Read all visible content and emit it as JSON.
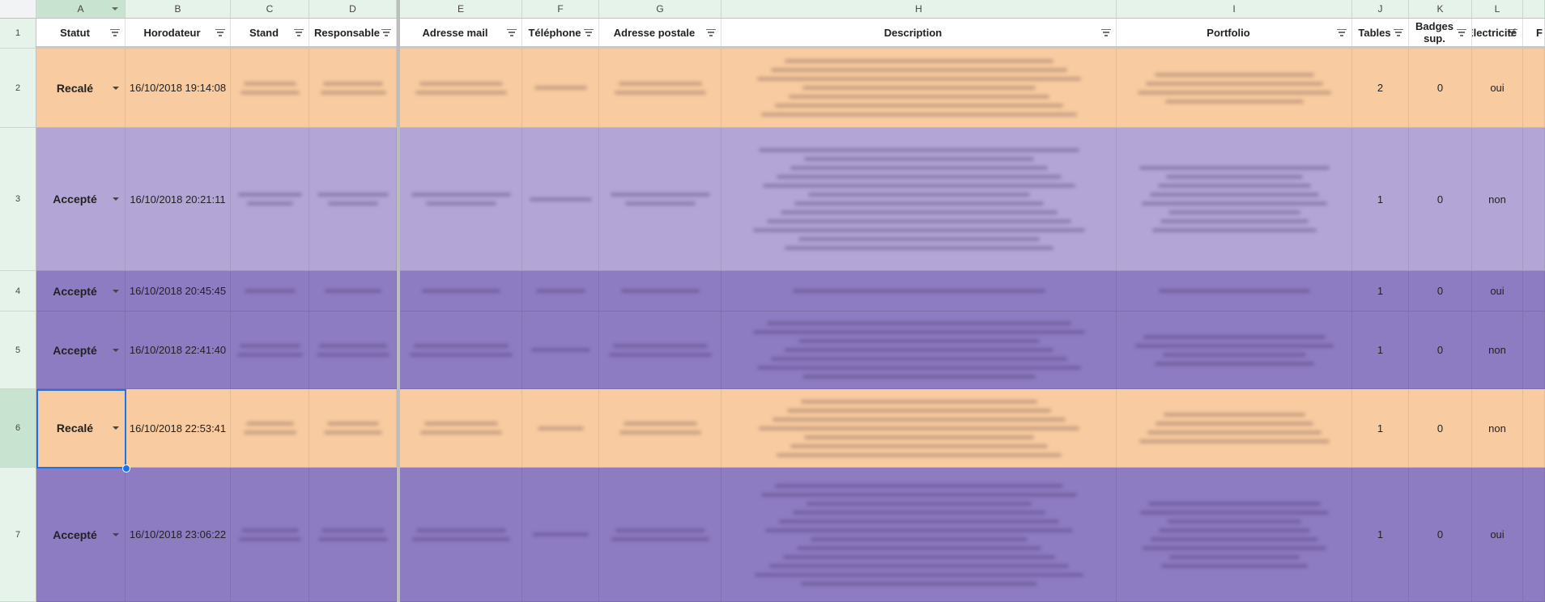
{
  "columns": [
    {
      "letter": "A"
    },
    {
      "letter": "B"
    },
    {
      "letter": "C"
    },
    {
      "letter": "D"
    },
    {
      "letter": "E"
    },
    {
      "letter": "F"
    },
    {
      "letter": "G"
    },
    {
      "letter": "H"
    },
    {
      "letter": "I"
    },
    {
      "letter": "J"
    },
    {
      "letter": "K"
    },
    {
      "letter": "L"
    }
  ],
  "header": {
    "statut": "Statut",
    "horodateur": "Horodateur",
    "stand": "Stand",
    "responsable": "Responsable",
    "adresse_mail": "Adresse mail",
    "telephone": "Téléphone",
    "adresse_postale": "Adresse postale",
    "description": "Description",
    "portfolio": "Portfolio",
    "tables": "Tables",
    "badges": "Badges sup.",
    "electricite": "Electricité",
    "next_truncated": "F"
  },
  "colors": {
    "recale": "#f8cba0",
    "accepte_light": "#b3a6d6",
    "accepte_dark": "#8e7cc3",
    "selection": "#1a73e8"
  },
  "rows": [
    {
      "num": "1"
    },
    {
      "num": "2",
      "statut": "Recalé",
      "horodateur": "16/10/2018 19:14:08",
      "tables": "2",
      "badges": "0",
      "electricite": "oui",
      "style": "recale"
    },
    {
      "num": "3",
      "statut": "Accepté",
      "horodateur": "16/10/2018 20:21:11",
      "tables": "1",
      "badges": "0",
      "electricite": "non",
      "style": "accepte_light"
    },
    {
      "num": "4",
      "statut": "Accepté",
      "horodateur": "16/10/2018 20:45:45",
      "tables": "1",
      "badges": "0",
      "electricite": "oui",
      "style": "accepte_dark"
    },
    {
      "num": "5",
      "statut": "Accepté",
      "horodateur": "16/10/2018 22:41:40",
      "tables": "1",
      "badges": "0",
      "electricite": "non",
      "style": "accepte_dark"
    },
    {
      "num": "6",
      "statut": "Recalé",
      "horodateur": "16/10/2018 22:53:41",
      "tables": "1",
      "badges": "0",
      "electricite": "non",
      "style": "recale"
    },
    {
      "num": "7",
      "statut": "Accepté",
      "horodateur": "16/10/2018 23:06:22",
      "tables": "1",
      "badges": "0",
      "electricite": "oui",
      "style": "accepte_dark"
    }
  ]
}
